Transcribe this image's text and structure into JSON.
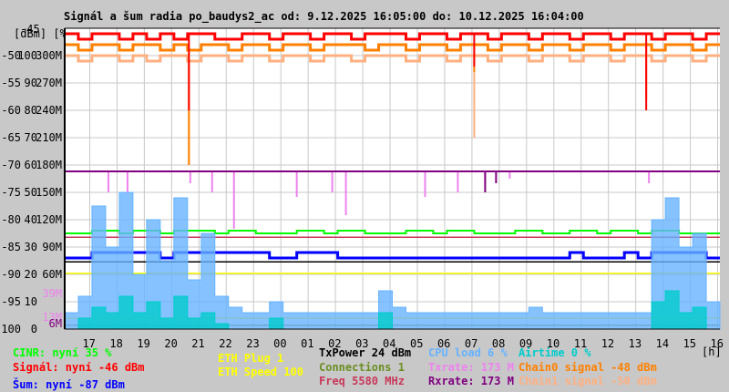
{
  "chart_data": {
    "type": "line",
    "title": "Signál a šum radia po_baudys2_ac od: 9.12.2025 16:05:00 do: 10.12.2025 16:04:00",
    "start_hour": 16.0833,
    "sample_step_hours": 0.5,
    "x_ticks": [
      "17",
      "18",
      "19",
      "20",
      "21",
      "22",
      "23",
      "00",
      "01",
      "02",
      "03",
      "04",
      "05",
      "06",
      "07",
      "08",
      "09",
      "10",
      "11",
      "12",
      "13",
      "14",
      "15",
      "16"
    ],
    "x_unit": "[h]",
    "y_header": "[dBm] [%]",
    "y_top_label": "-45",
    "ylim": [
      -100,
      -45
    ],
    "y_ticks": [
      {
        "dbm": "-50",
        "pct": "100",
        "rate": "300M"
      },
      {
        "dbm": "-55",
        "pct": "90",
        "rate": "270M"
      },
      {
        "dbm": "-60",
        "pct": "80",
        "rate": "240M"
      },
      {
        "dbm": "-65",
        "pct": "70",
        "rate": "210M"
      },
      {
        "dbm": "-70",
        "pct": "60",
        "rate": "180M"
      },
      {
        "dbm": "-75",
        "pct": "50",
        "rate": "150M"
      },
      {
        "dbm": "-80",
        "pct": "40",
        "rate": "120M"
      },
      {
        "dbm": "-85",
        "pct": "30",
        "rate": "90M"
      },
      {
        "dbm": "-90",
        "pct": "20",
        "rate": "60M"
      },
      {
        "dbm": "-95",
        "pct": "10",
        "rate": ""
      },
      {
        "dbm": "-100",
        "pct": "0",
        "rate": ""
      }
    ],
    "extra_rate_ticks": [
      {
        "label": "39M",
        "value": 39,
        "color": "#ee82ee"
      },
      {
        "label": "13M",
        "value": 13,
        "color": "#ee82ee"
      },
      {
        "label": "6M",
        "value": 6,
        "color": "#800080"
      }
    ],
    "series": [
      {
        "name": "Chain1 signal",
        "unit": "dBm",
        "color": "#ffb080",
        "values": [
          -50,
          -51,
          -50,
          -50,
          -51,
          -50,
          -51,
          -50,
          -50,
          -51,
          -50,
          -50,
          -51,
          -50,
          -50,
          -51,
          -50,
          -50,
          -51,
          -50,
          -50,
          -51,
          -50,
          -50,
          -50,
          -51,
          -50,
          -50,
          -51,
          -50,
          -50,
          -51,
          -50,
          -50,
          -51,
          -50,
          -50,
          -51,
          -50,
          -50,
          -51,
          -50,
          -50,
          -51,
          -50,
          -50,
          -51,
          -50
        ],
        "dips": [
          {
            "t": 4.55,
            "v": -70
          },
          {
            "t": 15.0,
            "v": -65
          }
        ]
      },
      {
        "name": "Chain0 signal",
        "unit": "dBm",
        "color": "#ff8000",
        "values": [
          -48,
          -49,
          -48,
          -48,
          -49,
          -48,
          -48,
          -49,
          -48,
          -49,
          -48,
          -48,
          -49,
          -48,
          -48,
          -49,
          -48,
          -48,
          -49,
          -48,
          -48,
          -48,
          -49,
          -48,
          -48,
          -49,
          -48,
          -48,
          -49,
          -48,
          -48,
          -49,
          -48,
          -48,
          -49,
          -48,
          -48,
          -49,
          -48,
          -48,
          -49,
          -48,
          -48,
          -49,
          -48,
          -48,
          -49,
          -48
        ],
        "dips": [
          {
            "t": 4.55,
            "v": -70
          },
          {
            "t": 15.0,
            "v": -53
          },
          {
            "t": 21.3,
            "v": -58
          }
        ]
      },
      {
        "name": "Signal",
        "unit": "dBm",
        "color": "#ff0000",
        "values": [
          -46,
          -47,
          -46,
          -46,
          -47,
          -46,
          -47,
          -46,
          -47,
          -46,
          -46,
          -47,
          -47,
          -46,
          -46,
          -47,
          -46,
          -46,
          -47,
          -46,
          -46,
          -47,
          -46,
          -46,
          -46,
          -47,
          -46,
          -46,
          -47,
          -46,
          -46,
          -47,
          -46,
          -46,
          -47,
          -46,
          -46,
          -47,
          -46,
          -46,
          -47,
          -46,
          -46,
          -47,
          -46,
          -46,
          -47,
          -46
        ],
        "dips": [
          {
            "t": 4.55,
            "v": -60
          },
          {
            "t": 15.0,
            "v": -52
          },
          {
            "t": 21.3,
            "v": -60
          }
        ]
      },
      {
        "name": "Noise",
        "unit": "dBm",
        "color": "#0000ff",
        "values": [
          -87,
          -87,
          -86,
          -86,
          -86,
          -86,
          -86,
          -87,
          -86,
          -86,
          -86,
          -86,
          -86,
          -86,
          -86,
          -87,
          -87,
          -86,
          -86,
          -86,
          -87,
          -87,
          -87,
          -87,
          -87,
          -87,
          -87,
          -87,
          -87,
          -87,
          -87,
          -87,
          -87,
          -87,
          -87,
          -87,
          -87,
          -86,
          -87,
          -87,
          -87,
          -86,
          -87,
          -86,
          -86,
          -86,
          -86,
          -87
        ]
      },
      {
        "name": "CINR",
        "unit": "%",
        "color": "#00ff00",
        "values": [
          35,
          35,
          36,
          36,
          35,
          36,
          36,
          35,
          36,
          36,
          36,
          35,
          36,
          36,
          35,
          35,
          35,
          36,
          36,
          35,
          36,
          36,
          35,
          35,
          35,
          36,
          36,
          35,
          36,
          36,
          35,
          35,
          35,
          36,
          36,
          35,
          35,
          36,
          36,
          35,
          36,
          36,
          35,
          36,
          36,
          35,
          35,
          35
        ]
      },
      {
        "name": "CPU load",
        "unit": "%",
        "color": "#66b3ff",
        "values": [
          6,
          12,
          45,
          30,
          50,
          20,
          40,
          25,
          48,
          18,
          35,
          12,
          8,
          6,
          6,
          10,
          6,
          6,
          6,
          6,
          6,
          6,
          6,
          14,
          8,
          6,
          6,
          6,
          6,
          6,
          6,
          6,
          6,
          6,
          8,
          6,
          6,
          6,
          6,
          6,
          6,
          6,
          6,
          40,
          48,
          30,
          35,
          10
        ]
      },
      {
        "name": "Airtime",
        "unit": "%",
        "color": "#00cccc",
        "values": [
          0,
          4,
          8,
          6,
          12,
          6,
          10,
          4,
          12,
          4,
          6,
          2,
          0,
          0,
          0,
          4,
          0,
          0,
          0,
          0,
          0,
          0,
          0,
          6,
          0,
          0,
          0,
          0,
          0,
          0,
          0,
          0,
          0,
          0,
          0,
          0,
          0,
          0,
          0,
          0,
          0,
          0,
          0,
          10,
          14,
          6,
          8,
          0
        ]
      },
      {
        "name": "Txrate",
        "unit": "M",
        "color": "#ee82ee",
        "values": [
          173,
          173,
          173,
          173,
          173,
          173,
          173,
          173,
          173,
          173,
          173,
          173,
          173,
          173,
          173,
          173,
          173,
          173,
          173,
          173,
          173,
          173,
          173,
          173,
          173,
          173,
          173,
          173,
          173,
          173,
          173,
          173,
          173,
          173,
          173,
          173,
          173,
          173,
          173,
          173,
          173,
          173,
          173,
          173,
          173,
          173,
          173,
          173
        ],
        "dips": [
          {
            "t": 1.6,
            "v": 150
          },
          {
            "t": 2.3,
            "v": 150
          },
          {
            "t": 4.6,
            "v": 160
          },
          {
            "t": 5.4,
            "v": 150
          },
          {
            "t": 6.2,
            "v": 110
          },
          {
            "t": 8.5,
            "v": 145
          },
          {
            "t": 9.8,
            "v": 150
          },
          {
            "t": 10.3,
            "v": 125
          },
          {
            "t": 13.2,
            "v": 145
          },
          {
            "t": 14.4,
            "v": 150
          },
          {
            "t": 15.4,
            "v": 160
          },
          {
            "t": 16.3,
            "v": 165
          },
          {
            "t": 21.4,
            "v": 160
          }
        ]
      },
      {
        "name": "Rxrate",
        "unit": "M",
        "color": "#800080",
        "values": [
          173,
          173,
          173,
          173,
          173,
          173,
          173,
          173,
          173,
          173,
          173,
          173,
          173,
          173,
          173,
          173,
          173,
          173,
          173,
          173,
          173,
          173,
          173,
          173,
          173,
          173,
          173,
          173,
          173,
          173,
          173,
          173,
          173,
          173,
          173,
          173,
          173,
          173,
          173,
          173,
          173,
          173,
          173,
          173,
          173,
          173,
          173,
          173
        ],
        "dips": [
          {
            "t": 15.4,
            "v": 150
          },
          {
            "t": 15.8,
            "v": 160
          }
        ]
      }
    ],
    "constant_lines": [
      {
        "name": "Freq",
        "color": "#c8385a",
        "level_dbm": -83.2
      },
      {
        "name": "TxPower",
        "color": "#000000",
        "level_dbm": -87.7
      },
      {
        "name": "ETH Plug",
        "color": "#ffff00",
        "level_dbm": -89.8
      },
      {
        "name": "ETH Speed",
        "color": "#ffff00",
        "level_dbm": -98
      },
      {
        "name": "Connections",
        "color": "#6b8e23",
        "level_dbm": -99.3
      }
    ],
    "legend": [
      {
        "text": "CINR: nyní 35 %",
        "color": "#00ff00"
      },
      {
        "text": "Signál: nyní -46 dBm",
        "color": "#ff0000"
      },
      {
        "text": "Šum: nyní -87 dBm",
        "color": "#0000ff"
      },
      {
        "text": "ETH Plug 1",
        "color": "#ffff00"
      },
      {
        "text": "ETH Speed 100",
        "color": "#ffff00"
      },
      {
        "text": "TxPower 24 dBm",
        "color": "#000000"
      },
      {
        "text": "Connections 1",
        "color": "#6b8e23"
      },
      {
        "text": "Freq 5580 MHz",
        "color": "#c8385a"
      },
      {
        "text": "CPU load 6 %",
        "color": "#66b3ff"
      },
      {
        "text": "Txrate: 173 M",
        "color": "#ee82ee"
      },
      {
        "text": "Rxrate: 173 M",
        "color": "#800080"
      },
      {
        "text": "Airtime 0 %",
        "color": "#00cccc"
      },
      {
        "text": "Chain0 signal -48 dBm",
        "color": "#ff8000"
      },
      {
        "text": "Chain1 signal -50 dBm",
        "color": "#ffb080"
      }
    ]
  }
}
